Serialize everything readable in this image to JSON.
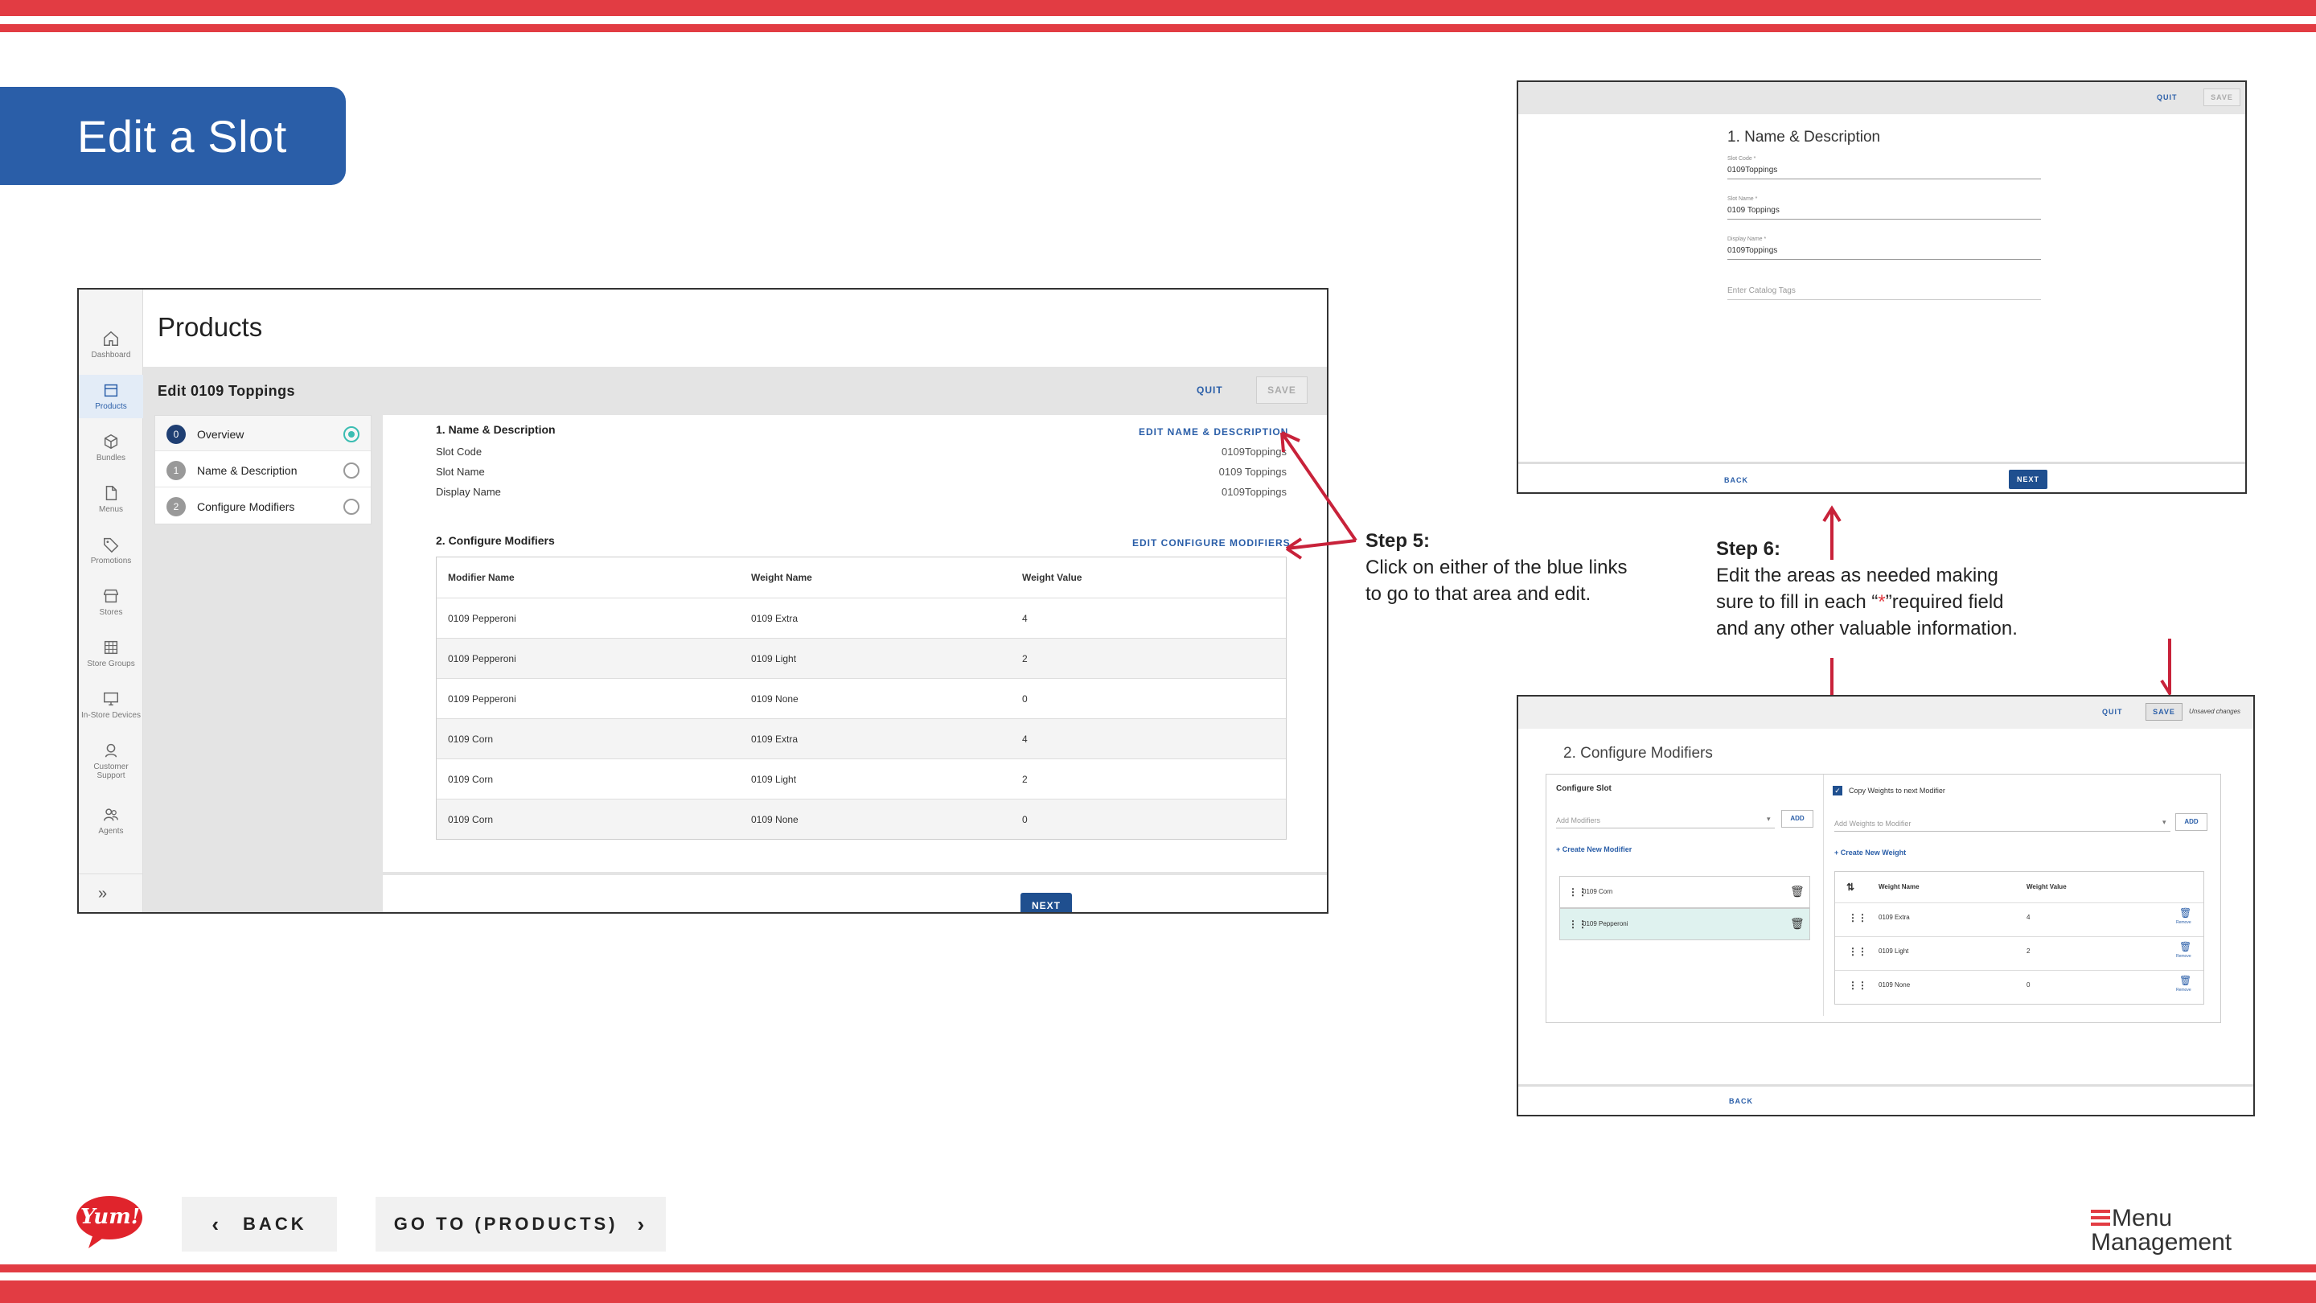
{
  "slide": {
    "title": "Edit a Slot",
    "brand_color": "#e23c43",
    "accent_color": "#2a5ea8"
  },
  "app": {
    "section_title": "Products",
    "edit_title": "Edit 0109 Toppings",
    "quit_label": "QUIT",
    "save_label": "SAVE",
    "nav": [
      {
        "label": "Dashboard",
        "icon": "home-icon"
      },
      {
        "label": "Products",
        "icon": "calendar-icon"
      },
      {
        "label": "Bundles",
        "icon": "cube-icon"
      },
      {
        "label": "Menus",
        "icon": "document-icon"
      },
      {
        "label": "Promotions",
        "icon": "tag-icon"
      },
      {
        "label": "Stores",
        "icon": "store-icon"
      },
      {
        "label": "Store Groups",
        "icon": "grid-icon"
      },
      {
        "label": "In-Store Devices",
        "icon": "monitor-icon"
      },
      {
        "label": "Customer Support",
        "icon": "headset-icon"
      },
      {
        "label": "Agents",
        "icon": "people-icon"
      }
    ],
    "steps": [
      {
        "num": "0",
        "label": "Overview"
      },
      {
        "num": "1",
        "label": "Name & Description"
      },
      {
        "num": "2",
        "label": "Configure Modifiers"
      }
    ],
    "name_desc": {
      "title": "1. Name & Description",
      "edit_link": "EDIT NAME & DESCRIPTION",
      "rows": [
        {
          "key": "Slot Code",
          "value": "0109Toppings"
        },
        {
          "key": "Slot Name",
          "value": "0109 Toppings"
        },
        {
          "key": "Display Name",
          "value": "0109Toppings"
        }
      ]
    },
    "modifiers": {
      "title": "2. Configure Modifiers",
      "edit_link": "EDIT CONFIGURE MODIFIERS",
      "headers": [
        "Modifier Name",
        "Weight Name",
        "Weight Value"
      ],
      "rows": [
        [
          "0109 Pepperoni",
          "0109 Extra",
          "4"
        ],
        [
          "0109 Pepperoni",
          "0109 Light",
          "2"
        ],
        [
          "0109 Pepperoni",
          "0109 None",
          "0"
        ],
        [
          "0109 Corn",
          "0109 Extra",
          "4"
        ],
        [
          "0109 Corn",
          "0109 Light",
          "2"
        ],
        [
          "0109 Corn",
          "0109 None",
          "0"
        ]
      ]
    },
    "next_label": "NEXT"
  },
  "step5": {
    "heading": "Step 5:",
    "line1": "Click on either of the blue links",
    "line2": "to go to that area and edit."
  },
  "step6": {
    "heading": "Step 6:",
    "line1": "Edit the areas as needed making",
    "line2a": "sure to fill in each “",
    "star": "*",
    "line2b": "”required field",
    "line3": "and any other valuable information."
  },
  "mini1": {
    "quit": "QUIT",
    "save": "SAVE",
    "title": "1. Name & Description",
    "fields": [
      {
        "label": "Slot Code *",
        "value": "0109Toppings"
      },
      {
        "label": "Slot Name *",
        "value": "0109 Toppings"
      },
      {
        "label": "Display Name *",
        "value": "0109Toppings"
      }
    ],
    "tags_placeholder": "Enter Catalog Tags",
    "back": "BACK",
    "next": "NEXT"
  },
  "mini2": {
    "quit": "QUIT",
    "save": "SAVE",
    "unsaved": "Unsaved changes",
    "title": "2. Configure Modifiers",
    "configure_slot": "Configure Slot",
    "add_modifiers": "Add Modifiers",
    "add": "ADD",
    "create_modifier": "Create New Modifier",
    "modifiers": [
      "0109 Corn",
      "0109 Pepperoni"
    ],
    "copy_weights": "Copy Weights to next Modifier",
    "add_weights": "Add Weights to Modifier",
    "create_weight": "Create New Weight",
    "weight_headers": [
      "Weight Name",
      "Weight Value"
    ],
    "weights": [
      [
        "0109 Extra",
        "4"
      ],
      [
        "0109 Light",
        "2"
      ],
      [
        "0109 None",
        "0"
      ]
    ],
    "remove": "Remove",
    "back": "BACK"
  },
  "footer": {
    "logo": "Yum!",
    "back": "BACK",
    "go_to": "GO TO (PRODUCTS)",
    "brand_line1": "Menu",
    "brand_line2": "Management"
  }
}
